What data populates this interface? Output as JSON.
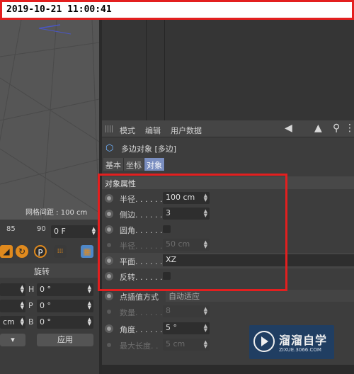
{
  "timestamp": "2019-10-21 11:00:41",
  "viewport": {
    "grid_label": "网格间距 : 100 cm"
  },
  "attributes": {
    "menu": [
      "模式",
      "编辑",
      "用户数据"
    ],
    "object_title": "多边对象 [多边]",
    "tabs": [
      "基本",
      "坐标",
      "对象"
    ],
    "active_tab": "对象",
    "section_title": "对象属性",
    "rows": [
      {
        "label": "半径. . . . . .",
        "value": "100 cm",
        "type": "number",
        "enabled": true
      },
      {
        "label": "侧边. . . . . .",
        "value": "3",
        "type": "number",
        "enabled": true
      },
      {
        "label": "圆角. . . . . .",
        "value": "",
        "type": "checkbox",
        "enabled": true
      },
      {
        "label": "半径. . . . . .",
        "value": "50 cm",
        "type": "number",
        "enabled": false
      },
      {
        "label": "平面. . . . . .",
        "value": "XZ",
        "type": "select",
        "enabled": true
      },
      {
        "label": "反转. . . . . .",
        "value": "",
        "type": "checkbox",
        "enabled": true
      }
    ],
    "interp_label": "点插值方式",
    "interp_value": "自动适应",
    "count_label": "数量. . . . . .",
    "count_value": "8",
    "angle_label": "角度. . . . . .",
    "angle_value": "5 °",
    "maxlen_label": "最大长度. .",
    "maxlen_value": "5 cm"
  },
  "timeline": {
    "tick_85": "85",
    "tick_90": "90",
    "frame_value": "0 F"
  },
  "coords": {
    "section_label": "旋转",
    "rows": [
      {
        "axis": "H",
        "value": "0 °"
      },
      {
        "axis": "P",
        "value": "0 °"
      },
      {
        "axis": "B",
        "value": "0 °"
      }
    ],
    "cm_label": "cm",
    "apply_label": "应用"
  },
  "watermark": {
    "brand": "溜溜自学",
    "url": "ZIXUE.3066.COM"
  }
}
